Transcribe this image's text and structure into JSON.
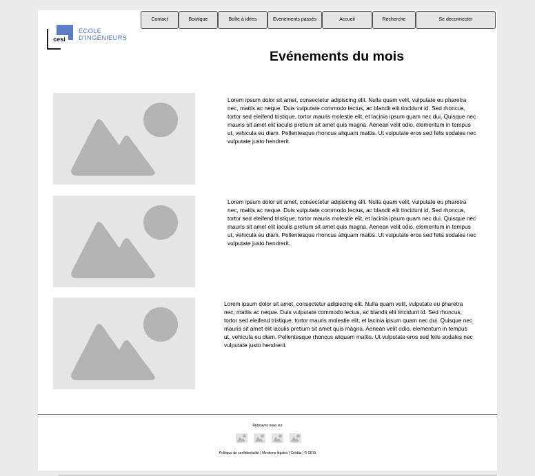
{
  "logo": {
    "mark": "cesi",
    "line1": "ÉCOLE",
    "line2": "D'INGÉNIEURS",
    "color": "#5b7ec7"
  },
  "nav": {
    "items": [
      {
        "label": "Contact"
      },
      {
        "label": "Boutique"
      },
      {
        "label": "Boîte à idées"
      },
      {
        "label": "Evenements passés"
      },
      {
        "label": "Accueil"
      },
      {
        "label": "Recherche"
      },
      {
        "label": "Se deconnecter"
      }
    ]
  },
  "main": {
    "title": "Evénements du mois",
    "events": [
      {
        "image": "image-placeholder-icon",
        "text": "Lorem ipsum dolor sit amet, consectetur adipiscing elit. Nulla quam velit, vulputate eu pharetra nec, mattis ac neque. Duis vulputate commodo lectus, ac blandit elit tincidunt id. Sed rhoncus, tortor sed eleifend tristique, tortor mauris molestie elit, et lacinia ipsum quam nec dui. Quisque nec mauris sit amet elit iaculis pretium sit amet quis magna. Aenean velit odio, elementum in tempus ut, vehicula eu diam. Pellentesque rhoncus aliquam mattis. Ut vulputate eros sed felis sodales nec vulputate justo hendrerit."
      },
      {
        "image": "image-placeholder-icon",
        "text": "Lorem ipsum dolor sit amet, consectetur adipiscing elit. Nulla quam velit, vulputate eu pharetra nec, mattis ac neque. Duis vulputate commodo lectus, ac blandit elit tincidunt id. Sed rhoncus, tortor sed eleifend tristique, tortor mauris molestie elit, et lacinia ipsum quam nec dui. Quisque nec mauris sit amet elit iaculis pretium sit amet quis magna. Aenean velit odio, elementum in tempus ut, vehicula eu diam. Pellentesque rhoncus aliquam mattis. Ut vulputate eros sed felis sodales nec vulputate justo hendrerit."
      },
      {
        "image": "image-placeholder-icon",
        "text": "Lorem ipsum dolor sit amet, consectetur adipiscing elit. Nulla quam velit, vulputate eu pharetra nec, mattis ac neque. Duis vulputate commodo lectus, ac blandit elit tincidunt id. Sed rhoncus, tortor sed eleifend tristique, tortor mauris molestie elit, et lacinia ipsum quam nec dui. Quisque nec mauris sit amet elit iaculis pretium sit amet quis magna. Aenean velit odio, elementum in tempus ut, vehicula eu diam. Pellentesque rhoncus aliquam mattis. Ut vulputate eros sed felis sodales nec vulputate justo hendrerit."
      }
    ]
  },
  "footer": {
    "follow_label": "Retrouvez nous sur",
    "socials": [
      "social-image-icon",
      "social-image-icon",
      "social-image-icon",
      "social-image-icon"
    ],
    "links": {
      "privacy": "Politique de confidentialité",
      "legal": "Mentions légales",
      "credits": "Crédits",
      "copyright": "© CESI",
      "separator": " | "
    }
  }
}
